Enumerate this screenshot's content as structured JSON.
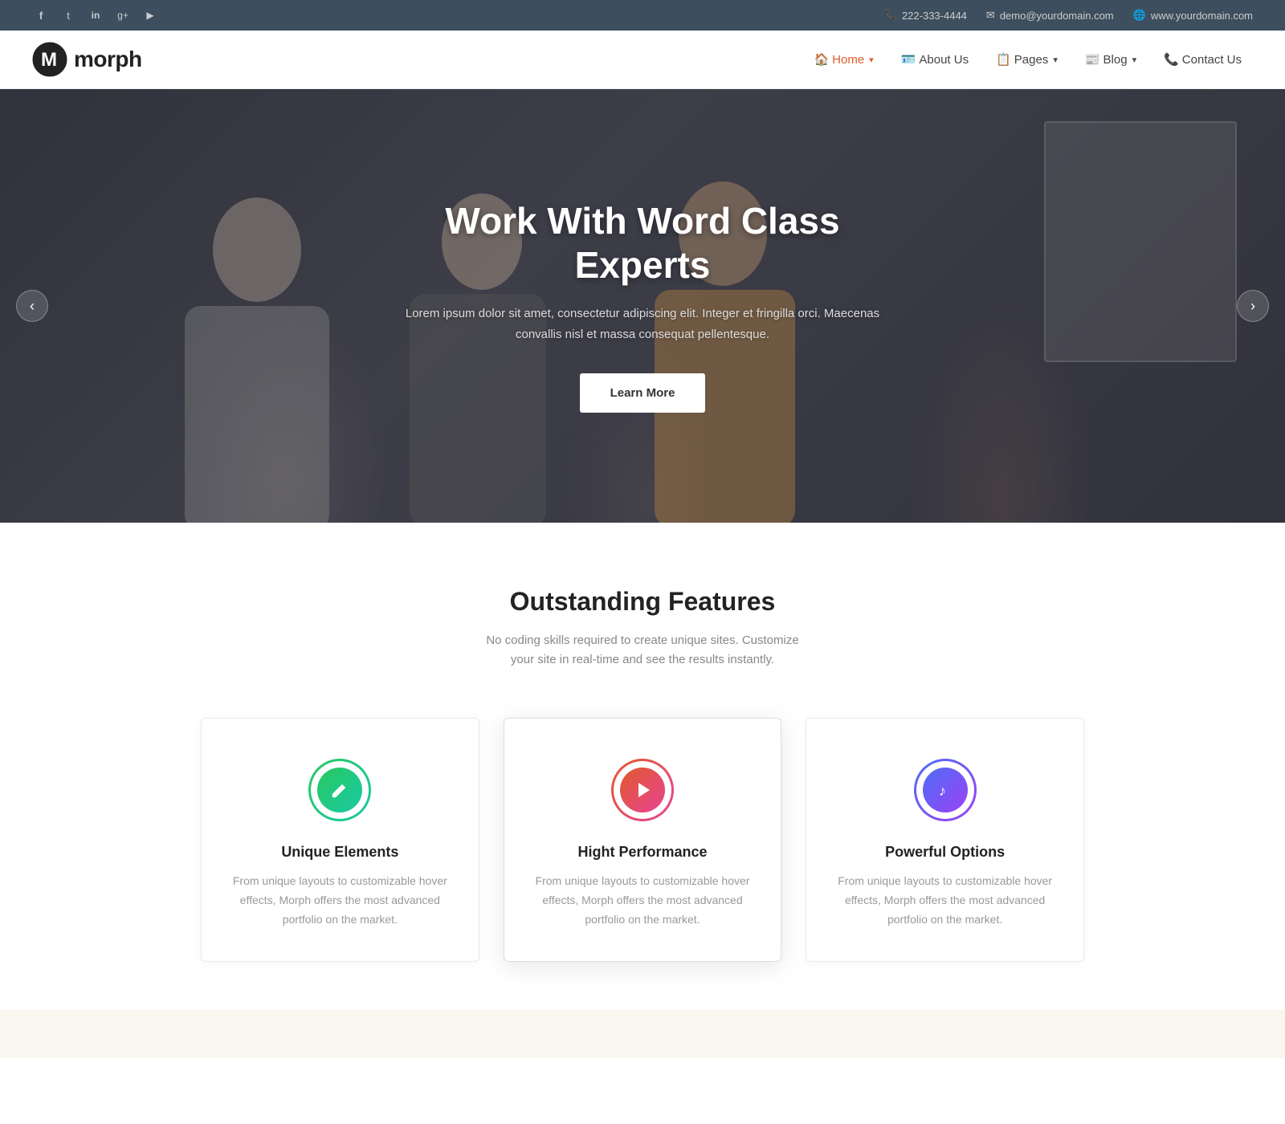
{
  "topbar": {
    "phone": "222-333-4444",
    "email": "demo@yourdomain.com",
    "website": "www.yourdomain.com",
    "social": [
      {
        "name": "facebook",
        "label": "f"
      },
      {
        "name": "twitter",
        "label": "t"
      },
      {
        "name": "linkedin",
        "label": "in"
      },
      {
        "name": "google-plus",
        "label": "g+"
      },
      {
        "name": "youtube",
        "label": "▶"
      }
    ]
  },
  "header": {
    "logo_text": "morph",
    "nav_items": [
      {
        "label": "Home",
        "icon": "🏠",
        "active": true,
        "has_arrow": true
      },
      {
        "label": "About Us",
        "icon": "🪪",
        "active": false,
        "has_arrow": false
      },
      {
        "label": "Pages",
        "icon": "📋",
        "active": false,
        "has_arrow": true
      },
      {
        "label": "Blog",
        "icon": "📰",
        "active": false,
        "has_arrow": true
      },
      {
        "label": "Contact Us",
        "icon": "📞",
        "active": false,
        "has_arrow": false
      }
    ]
  },
  "hero": {
    "title": "Work With Word Class Experts",
    "subtitle": "Lorem ipsum dolor sit amet, consectetur adipiscing elit. Integer et fringilla orci. Maecenas convallis nisl et massa consequat pellentesque.",
    "cta_label": "Learn More",
    "prev_label": "‹",
    "next_label": "›"
  },
  "features": {
    "title": "Outstanding Features",
    "subtitle": "No coding skills required to create unique sites. Customize your site in real-time and see the results instantly.",
    "items": [
      {
        "icon": "✏",
        "color_class": "green",
        "title": "Unique Elements",
        "desc": "From unique layouts to customizable hover effects, Morph offers the most advanced portfolio on the market."
      },
      {
        "icon": "▶",
        "color_class": "red",
        "title": "Hight Performance",
        "desc": "From unique layouts to customizable hover effects, Morph offers the most advanced portfolio on the market."
      },
      {
        "icon": "♪",
        "color_class": "blue",
        "title": "Powerful Options",
        "desc": "From unique layouts to customizable hover effects, Morph offers the most advanced portfolio on the market."
      }
    ]
  }
}
